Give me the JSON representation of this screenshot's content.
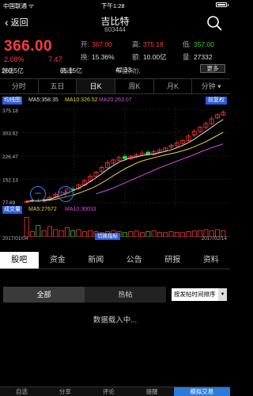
{
  "status_bar": {
    "carrier": "中国联通 ᯤ",
    "time": "下午1:28"
  },
  "nav": {
    "back_label": "返回",
    "title": "吉比特",
    "code": "603444"
  },
  "quote": {
    "price": "366.00",
    "change_pct": "2.08%",
    "change_val": "7.47",
    "open_label": "开:",
    "open": "367.00",
    "high_label": "高:",
    "high": "375.18",
    "low_label": "低:",
    "low": "357.00",
    "turnover_label": "换:",
    "turnover": "15.36%",
    "amount_label": "额:",
    "amount": "10.00亿",
    "volume_label": "量:",
    "volume": "27332",
    "cap_label": "总值:",
    "cap": "260.5亿",
    "float_label": "流通:",
    "float_cap": "65.15亿",
    "pe_label": "市盈(动):",
    "pe": "42.33",
    "more_label": "更多"
  },
  "period_tabs": [
    "分时",
    "五日",
    "日K",
    "周K",
    "月K",
    "分钟 ▾"
  ],
  "chart": {
    "tag_label": "均线图",
    "ma5": "MA5:358.35",
    "ma10": "MA10:326.52",
    "ma20": "MA20:263.07",
    "fq_label": "前复权",
    "vol_tag": "成交量",
    "vol_label": "2790",
    "vol_ma5": "MA5:27672",
    "vol_ma10": "MA10:30033",
    "date_start": "2017/01/04",
    "date_end": "2017/02/14",
    "cut_label": "切换指标",
    "zoom_out": "−",
    "zoom_in": "+"
  },
  "chart_data": {
    "type": "candlestick",
    "y_ticks": [
      "375.18",
      "303.62",
      "226.47",
      "152.13",
      "77.69"
    ],
    "ylim": [
      77.69,
      375.18
    ],
    "x_range": [
      "2017/01/04",
      "2017/02/14"
    ],
    "candles_close": [
      82,
      86,
      84,
      88,
      95,
      104,
      112,
      122,
      120,
      135,
      148,
      162,
      175,
      190,
      205,
      214,
      222,
      218,
      226,
      230,
      236,
      232,
      240,
      245,
      252,
      260,
      268,
      276,
      290,
      305,
      318,
      330,
      345,
      358,
      366
    ],
    "ma5": [
      82,
      84,
      85,
      86,
      89,
      95,
      101,
      108,
      116,
      124,
      134,
      145,
      157,
      170,
      184,
      196,
      207,
      214,
      221,
      224,
      228,
      231,
      233,
      237,
      241,
      246,
      253,
      260,
      269,
      280,
      293,
      305,
      318,
      331,
      343
    ],
    "ma10": [
      82,
      83,
      84,
      85,
      86,
      89,
      93,
      97,
      102,
      108,
      115,
      122,
      131,
      141,
      152,
      164,
      175,
      186,
      195,
      204,
      211,
      216,
      221,
      226,
      230,
      234,
      238,
      243,
      249,
      256,
      264,
      272,
      282,
      292,
      302
    ],
    "ma20": [
      null,
      null,
      null,
      null,
      null,
      null,
      null,
      null,
      null,
      null,
      null,
      null,
      106,
      112,
      118,
      125,
      133,
      141,
      149,
      157,
      165,
      173,
      181,
      189,
      196,
      203,
      210,
      217,
      224,
      231,
      239,
      246,
      253,
      259,
      265
    ],
    "volumes": [
      0.95,
      0.25,
      0.55,
      0.3,
      0.5,
      0.35,
      0.3,
      0.45,
      0.3,
      0.35,
      0.25,
      0.3,
      0.25,
      0.2,
      0.25,
      0.3,
      0.25,
      0.2,
      0.25,
      0.28,
      0.2,
      0.25,
      0.3,
      0.22,
      0.2,
      0.25,
      0.22,
      0.2,
      0.25,
      0.28,
      0.3,
      0.35,
      0.3,
      0.35,
      0.3
    ],
    "colors": {
      "up": "#ff3b3b",
      "down": "#2fd23f",
      "ma5": "#dddddd",
      "ma10": "#e8d23a",
      "ma20": "#d24fd6",
      "grid": "#333333"
    }
  },
  "info_tabs": [
    "股吧",
    "资金",
    "新闻",
    "公告",
    "研报",
    "资料"
  ],
  "sub_tabs": [
    "全部",
    "热帖"
  ],
  "sort_label": "按发帖时间排序",
  "loading_text": "数据载入中...",
  "bottom_bar": [
    "自选",
    "分享",
    "评论",
    "提醒",
    "模拟交易"
  ],
  "colors": {
    "accent": "#2a5cd9",
    "up": "#ff3b3b",
    "down": "#2fd23f"
  }
}
